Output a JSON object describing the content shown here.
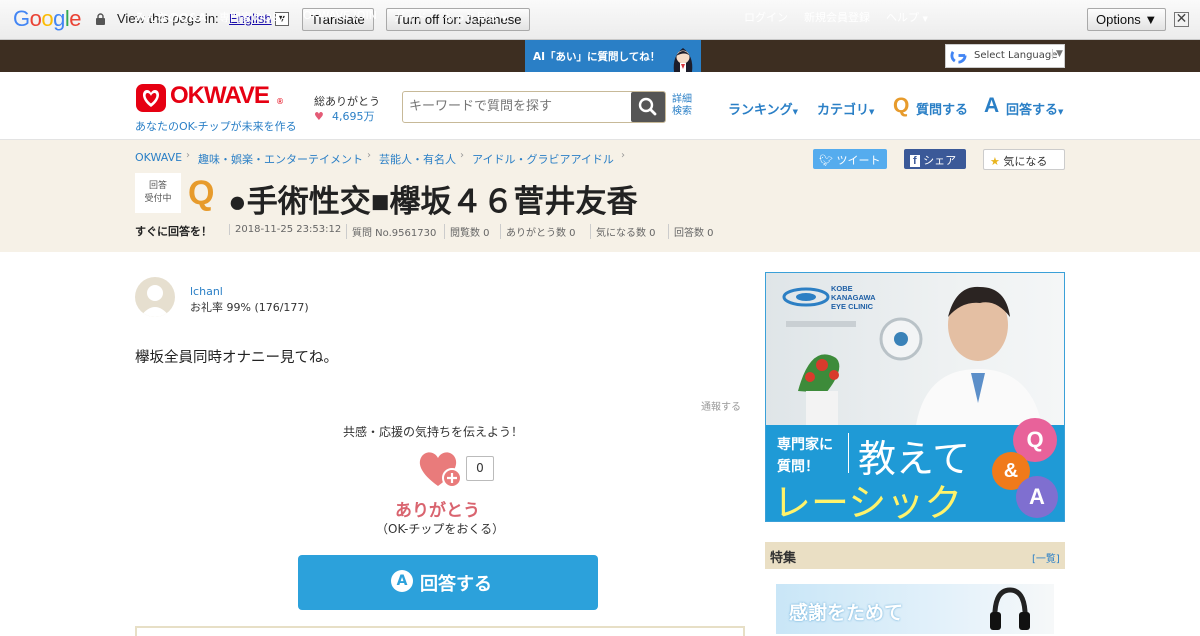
{
  "translate_bar": {
    "google_letters": [
      "G",
      "o",
      "o",
      "g",
      "l",
      "e"
    ],
    "view_prefix": "View this page in:",
    "language": "English",
    "translate_label": "Translate",
    "turn_off_label": "Turn off for: Japanese",
    "options_label": "Options ▼",
    "close_glyph": "✕"
  },
  "top_nav": {
    "items": [
      "みんなのQ&A",
      "専門家のQ&A",
      "OKWAVE JOIN",
      "ガイド",
      "もっと見る"
    ],
    "ai_banner": "AI「あい」に質問してね！",
    "right_items": [
      "ログイン",
      "新規会員登録",
      "ヘルプ"
    ],
    "select_language": "Select Language",
    "caret": "▼"
  },
  "header": {
    "logo_text": "OKWAVE",
    "logo_mark": "®",
    "tagline": "あなたのOK-チップが未来を作る",
    "thanks_label": "総ありがとう",
    "thanks_count": "4,695万",
    "search_placeholder": "キーワードで質問を探す",
    "detail_search": "詳細検索",
    "nav": [
      "ランキング",
      "カテゴリ",
      "質問する",
      "回答する"
    ],
    "q_letter": "Q",
    "a_letter": "A"
  },
  "breadcrumb": [
    "OKWAVE",
    "趣味・娯楽・エンターテイメント",
    "芸能人・有名人",
    "アイドル・グラビアアイドル"
  ],
  "share": {
    "tweet": "ツイート",
    "facebook": "シェア",
    "watch": "気になる"
  },
  "question": {
    "status_line1": "回答",
    "status_line2": "受付中",
    "letter": "Q",
    "title": "●手術性交■欅坂４６菅井友香",
    "answer_now": "すぐに回答を！",
    "meta": [
      "2018-11-25 23:53:12",
      "質問 No.9561730",
      "閲覧数 0",
      "ありがとう数 0",
      "気になる数 0",
      "回答数 0"
    ],
    "user": "lchanl",
    "rate": "お礼率 99%  (176/177)",
    "body": "欅坂全員同時オナニー見てね。",
    "report": "通報する",
    "cheer": "共感・応援の気持ちを伝えよう！",
    "heart_count": "0",
    "arigatou": "ありがとう",
    "okchip": "（OK-チップをおくる）",
    "answer_button": "回答する",
    "answer_button_letter": "A"
  },
  "ad": {
    "clinic_line1": "KOBE",
    "clinic_line2": "KANAGAWA",
    "clinic_line3": "EYE CLINIC",
    "sub_line1": "専門家に",
    "sub_line2": "質問！",
    "big1": "教えて",
    "big2": "レーシック",
    "bubble_q": "Q",
    "bubble_amp": "&",
    "bubble_a": "A"
  },
  "feature": {
    "label": "特集",
    "list_link": "[一覧]",
    "banner_text": "感謝をためて"
  },
  "colors": {
    "nav_bg": "#3d2e21",
    "brand_red": "#e60012",
    "link_blue": "#2a7fc6",
    "accent_orange": "#e79b2c",
    "answer_button": "#2ca1db"
  }
}
